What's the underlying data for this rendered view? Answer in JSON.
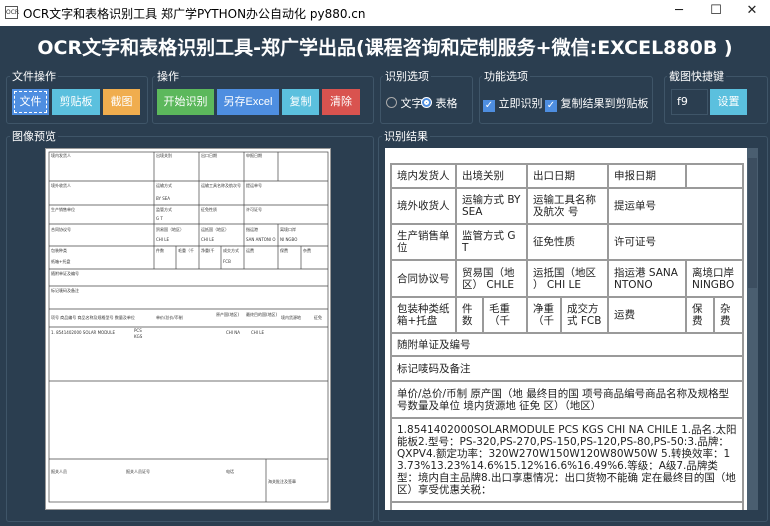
{
  "window": {
    "title": "OCR文字和表格识别工具 郑广学PYTHON办公自动化 py880.cn",
    "icon_text": "OCR",
    "minimize": "─",
    "maximize": "☐",
    "close": "✕"
  },
  "heading": "OCR文字和表格识别工具-郑广学出品(课程咨询和定制服务+微信:EXCEL880B )",
  "groups": {
    "file_ops": {
      "label": "文件操作",
      "file": "文件",
      "clipboard": "剪贴板",
      "screenshot": "截图"
    },
    "ops": {
      "label": "操作",
      "start": "开始识别",
      "save_excel": "另存Excel",
      "copy": "复制",
      "clear": "清除"
    },
    "recog": {
      "label": "识别选项",
      "text": "文字",
      "table": "表格",
      "selected": "表格"
    },
    "func": {
      "label": "功能选项",
      "instant": "立即识别",
      "instant_checked": true,
      "copy_to_clip": "复制结果到剪贴板",
      "copy_checked": true
    },
    "hotkey": {
      "label": "截图快捷键",
      "value": "f9",
      "set": "设置"
    }
  },
  "preview": {
    "label": "图像预览",
    "cells": [
      "境内发货人",
      "出境关别",
      "出口日期",
      "申报日期",
      "境外收货人",
      "运输方式",
      "运输工具名称及航次号",
      "提运单号",
      "BY SEA",
      "生产销售单位",
      "监管方式",
      "征免性质",
      "许可证号",
      "G T",
      "合同协议号",
      "贸易国（地区）",
      "运抵国（地区）",
      "指运港",
      "离境口岸",
      "CHI LE",
      "CHI LE",
      "SAN ANTONI O",
      "NI NGBO",
      "包装种类",
      "件数",
      "毛重（千",
      "净重(千",
      "成交方式",
      "运费",
      "保费",
      "杂费",
      "纸箱+托盘",
      "FCB",
      "随附单证及编号",
      "标记唛码及备注",
      "项号 商品编号 商品名称及规格型号 数量及单位",
      "单价/总价/币制",
      "原产国(地区)",
      "最终目的国(地区)",
      "境内货源地",
      "征免",
      "1. 8541402000 SOLAR MODULE",
      "PCS",
      "KGS",
      "CHI NA",
      "CHI LE",
      "报关人员",
      "报关人员证号",
      "电话",
      "海关批注及签章"
    ]
  },
  "result": {
    "label": "识别结果",
    "rows": [
      [
        "境内发货人",
        "出境关别",
        "出口日期",
        "申报日期",
        ""
      ],
      [
        "境外收货人",
        "运输方式 BYSEA",
        "运输工具名称及航次 号",
        "提运单号"
      ],
      [
        "生产销售单位",
        "监管方式 GT",
        "征免性质",
        "许可证号"
      ],
      [
        "合同协议号",
        "贸易国（地区） CHLE",
        "运抵国（地区 ） CHI LE",
        "指运港 SANANTONO",
        "离境口岸 NINGBO"
      ],
      [
        "包装种类纸箱+托盘",
        "件数",
        "毛重（千",
        "净重（千",
        "成交方式 FCB",
        "运费",
        "保费",
        "杂费"
      ],
      [
        "随附单证及编号"
      ],
      [
        "标记唛码及备注"
      ],
      [
        "单价/总价/币制 原产国（地 最终目的国 项号商品编号商品名称及规格型号数量及单位 境内货源地 征免 区）（地区）"
      ],
      [
        "1.8541402000SOLARMODULE PCS KGS CHI NA CHILE 1.品名.太阳能板2.型号：PS-320,PS-270,PS-150,PS-120,PS-80,PS-50:3.品牌：QXPV4.额定功率：320W270W150W120W80W50W 5.转换效率：13.73%13.23%14.6%15.12%16.6%16.49%6.等级：A级7.品牌类型：境内自主品牌8.出口享惠情况：出口货物不能确 定在最终目的国（地区）享受优惠关税："
      ],
      [
        ""
      ]
    ]
  },
  "colors": {
    "bg": "#2b3e50",
    "primary": "#4e8ee0",
    "info": "#5bc0de",
    "warning": "#f0ad4e",
    "success": "#5cb85c",
    "danger": "#d9534f"
  }
}
